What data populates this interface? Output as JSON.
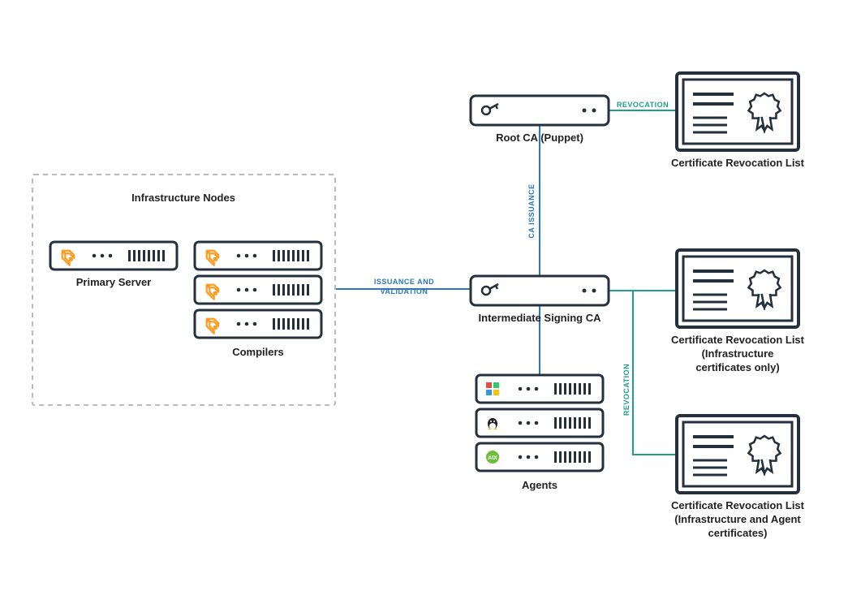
{
  "group": {
    "title": "Infrastructure Nodes"
  },
  "nodes": {
    "primary": {
      "label": "Primary Server"
    },
    "compilers": {
      "label": "Compilers"
    },
    "rootca": {
      "label": "Root CA (Puppet)"
    },
    "intca": {
      "label": "Intermediate Signing CA"
    },
    "agents": {
      "label": "Agents"
    },
    "crl1": {
      "label": "Certificate Revocation List"
    },
    "crl2": {
      "labelL1": "Certificate Revocation List",
      "labelL2": "(Infrastructure",
      "labelL3": "certificates only)"
    },
    "crl3": {
      "labelL1": "Certificate Revocation List",
      "labelL2": "(Infrastructure and Agent",
      "labelL3": "certificates)"
    }
  },
  "edges": {
    "revocation1": "REVOCATION",
    "caissuance": "CA ISSUANCE",
    "issuancevalidationL1": "ISSUANCE AND",
    "issuancevalidationL2": "VALIDATION",
    "revocation2": "REVOCATION"
  },
  "icons": {
    "puppetOrange": "#ff9b1e",
    "windows": "windows-icon",
    "linux": "linux-icon",
    "aix": "aix-icon",
    "key": "key-icon",
    "cert": "certificate-icon"
  },
  "colors": {
    "stroke": "#25303d",
    "blue": "#2b77c0",
    "teal": "#1fa08a",
    "dash": "#b6bbc0"
  }
}
